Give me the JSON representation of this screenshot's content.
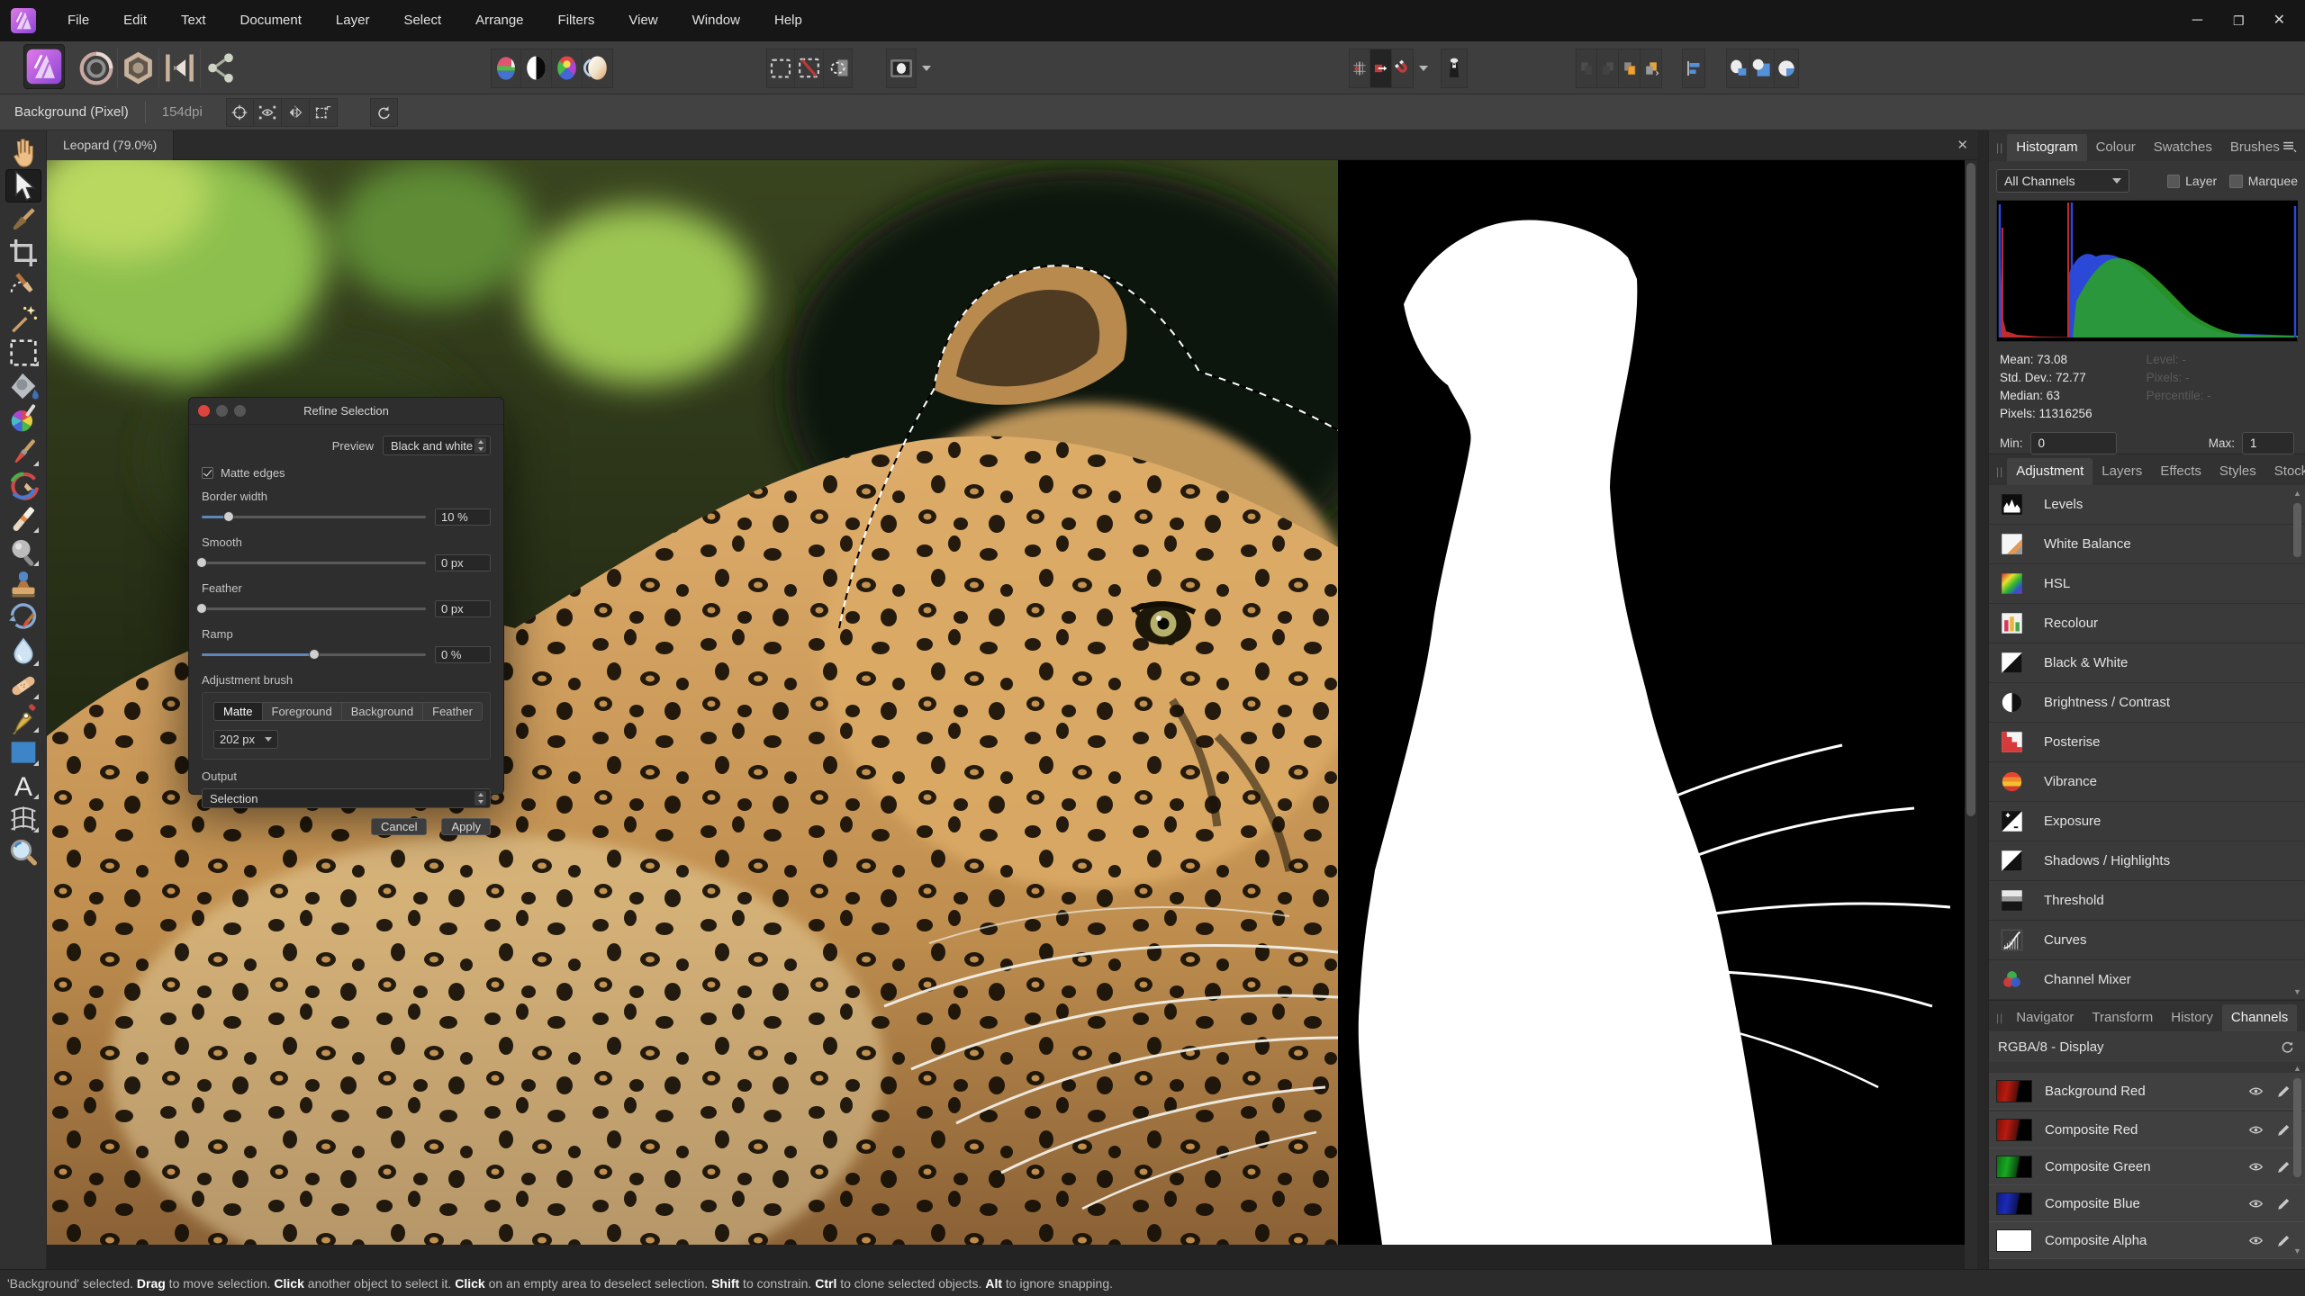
{
  "colors": {
    "accent_blue": "#5e87b8",
    "selection_red": "#c23b3b",
    "panel_bg": "#363636",
    "toolbar_bg": "#3e3e3e",
    "menu_bg": "#161616",
    "status_bg": "#2b2b2b",
    "insert_orange": "#e8a33d"
  },
  "menu_bar": {
    "items": [
      "File",
      "Edit",
      "Text",
      "Document",
      "Layer",
      "Select",
      "Arrange",
      "Filters",
      "View",
      "Window",
      "Help"
    ]
  },
  "window_controls": [
    "minimize",
    "restore",
    "close"
  ],
  "toolbar": {
    "app_button_icon": "affinity-photo",
    "personas": [
      "liquify-persona",
      "develop-persona",
      "tone-mapping-persona",
      "export-persona"
    ],
    "auto_group": [
      "auto-levels",
      "auto-contrast",
      "auto-colour",
      "auto-white-balance"
    ],
    "selection_group": [
      "select-all",
      "deselect",
      "invert-selection"
    ],
    "quick_mask": "quick-mask",
    "snapping_group": [
      "snapping-grid",
      "move-by-whole-pixels",
      "snapping-magnet"
    ],
    "assistant": "assistant",
    "arrange_group": [
      "arrange-dim-1",
      "arrange-dim-2",
      "insert-inside",
      "insert-behind"
    ],
    "alignment": "alignment",
    "mask_group": [
      "mask-ellipse",
      "mask-rect",
      "mask-circle"
    ]
  },
  "context_toolbar": {
    "layer_label": "Background (Pixel)",
    "dpi": "154dpi",
    "icons": [
      "ctx-target",
      "ctx-eye",
      "ctx-flip",
      "ctx-transform"
    ],
    "lone_icon": "ctx-rotate"
  },
  "document_tab": {
    "title": "Leopard (79.0%)",
    "close": "✕"
  },
  "tools": [
    {
      "name": "view-tool",
      "icon": "hand"
    },
    {
      "name": "move-tool",
      "icon": "cursor",
      "active": true
    },
    {
      "name": "colour-picker-tool",
      "icon": "dropper"
    },
    {
      "name": "crop-tool",
      "icon": "crop"
    },
    {
      "name": "selection-brush-tool",
      "icon": "selection-brush"
    },
    {
      "name": "flood-select-tool",
      "icon": "wand"
    },
    {
      "name": "marquee-select-tool",
      "icon": "marquee",
      "flyout": true
    },
    {
      "name": "flood-fill-tool",
      "icon": "bucket"
    },
    {
      "name": "gradient-tool",
      "icon": "gradient"
    },
    {
      "name": "paint-brush-tool",
      "icon": "brush",
      "flyout": true
    },
    {
      "name": "colour-replacement-brush-tool",
      "icon": "colour-brush"
    },
    {
      "name": "erase-brush-tool",
      "icon": "eraser",
      "flyout": true
    },
    {
      "name": "dodge-brush-tool",
      "icon": "dodge",
      "flyout": true
    },
    {
      "name": "clone-brush-tool",
      "icon": "clone"
    },
    {
      "name": "undo-brush-tool",
      "icon": "undo-brush"
    },
    {
      "name": "blur-brush-tool",
      "icon": "blur",
      "flyout": true
    },
    {
      "name": "healing-brush-tool",
      "icon": "healing",
      "flyout": true
    },
    {
      "name": "pen-tool",
      "icon": "pen",
      "flyout": true
    },
    {
      "name": "shape-tool",
      "icon": "shape",
      "flyout": true
    },
    {
      "name": "text-tool",
      "icon": "text",
      "flyout": true
    },
    {
      "name": "mesh-warp-tool",
      "icon": "mesh",
      "flyout": true
    },
    {
      "name": "zoom-tool",
      "icon": "zoom"
    }
  ],
  "dialog": {
    "title": "Refine Selection",
    "preview_label": "Preview",
    "preview_value": "Black and white",
    "matte_edges_label": "Matte edges",
    "matte_edges_checked": true,
    "sliders": [
      {
        "label": "Border width",
        "value": "10 %",
        "pos": 12
      },
      {
        "label": "Smooth",
        "value": "0 px",
        "pos": 0
      },
      {
        "label": "Feather",
        "value": "0 px",
        "pos": 0
      },
      {
        "label": "Ramp",
        "value": "0 %",
        "pos": 50
      }
    ],
    "adjustment_brush_label": "Adjustment brush",
    "brush_modes": [
      "Matte",
      "Foreground",
      "Background",
      "Feather"
    ],
    "active_mode": "Matte",
    "brush_size": "202 px",
    "output_label": "Output",
    "output_value": "Selection",
    "cancel_label": "Cancel",
    "apply_label": "Apply"
  },
  "histogram_panel": {
    "tabs": [
      "Histogram",
      "Colour",
      "Swatches",
      "Brushes"
    ],
    "active_tab": "Histogram",
    "channel_selector": "All Channels",
    "layer_label": "Layer",
    "marquee_label": "Marquee",
    "stats": [
      "Mean: 73.08",
      "Std. Dev.: 72.77",
      "Median: 63",
      "Pixels: 11316256"
    ],
    "dim_stats": [
      "Level: -",
      "Pixels: -",
      "Percentile: -"
    ],
    "min_label": "Min:",
    "min_value": "0",
    "max_label": "Max:",
    "max_value": "1"
  },
  "adjustment_panel": {
    "tabs": [
      "Adjustment",
      "Layers",
      "Effects",
      "Styles",
      "Stock"
    ],
    "active_tab": "Adjustment",
    "items": [
      {
        "label": "Levels",
        "icon": "aj-levels"
      },
      {
        "label": "White Balance",
        "icon": "aj-white-balance"
      },
      {
        "label": "HSL",
        "icon": "aj-hsl"
      },
      {
        "label": "Recolour",
        "icon": "aj-recolour"
      },
      {
        "label": "Black & White",
        "icon": "aj-black-white"
      },
      {
        "label": "Brightness / Contrast",
        "icon": "aj-brightness"
      },
      {
        "label": "Posterise",
        "icon": "aj-posterise"
      },
      {
        "label": "Vibrance",
        "icon": "aj-vibrance"
      },
      {
        "label": "Exposure",
        "icon": "aj-exposure"
      },
      {
        "label": "Shadows / Highlights",
        "icon": "aj-shadows"
      },
      {
        "label": "Threshold",
        "icon": "aj-threshold"
      },
      {
        "label": "Curves",
        "icon": "aj-curves"
      },
      {
        "label": "Channel Mixer",
        "icon": "aj-mixer"
      }
    ]
  },
  "channels_panel": {
    "tabs": [
      "Navigator",
      "Transform",
      "History",
      "Channels"
    ],
    "active_tab": "Channels",
    "header": "RGBA/8 - Display",
    "channels": [
      {
        "label": "Composite Red",
        "thumb": "t-red"
      },
      {
        "label": "Composite Green",
        "thumb": "t-green"
      },
      {
        "label": "Composite Blue",
        "thumb": "t-blue"
      },
      {
        "label": "Composite Alpha",
        "thumb": "t-white"
      },
      {
        "label": "Background Red",
        "thumb": "t-red",
        "separate": true
      }
    ]
  },
  "status_bar": {
    "segments": [
      {
        "text": "'Background' selected. ",
        "bold": false
      },
      {
        "text": "Drag",
        "bold": true
      },
      {
        "text": " to move selection. ",
        "bold": false
      },
      {
        "text": "Click",
        "bold": true
      },
      {
        "text": " another object to select it. ",
        "bold": false
      },
      {
        "text": "Click",
        "bold": true
      },
      {
        "text": " on an empty area to deselect selection. ",
        "bold": false
      },
      {
        "text": "Shift",
        "bold": true
      },
      {
        "text": " to constrain. ",
        "bold": false
      },
      {
        "text": "Ctrl",
        "bold": true
      },
      {
        "text": " to clone selected objects. ",
        "bold": false
      },
      {
        "text": "Alt",
        "bold": true
      },
      {
        "text": " to ignore snapping.",
        "bold": false
      }
    ]
  }
}
